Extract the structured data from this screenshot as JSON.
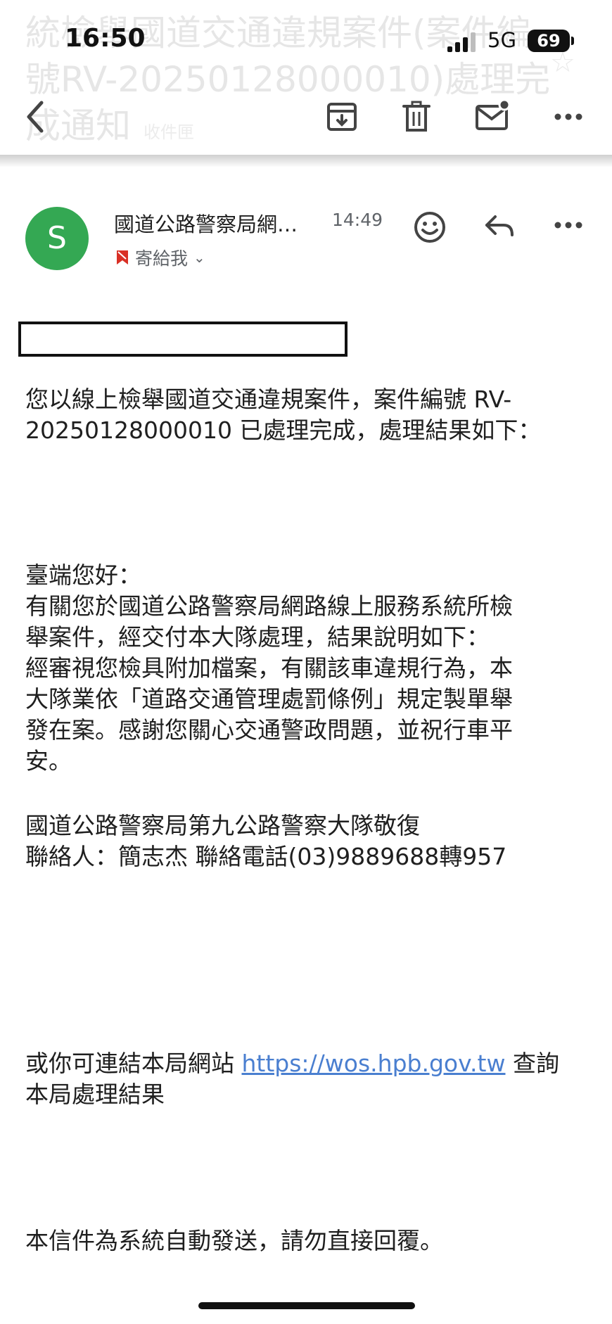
{
  "subject_ghost": {
    "title": "統檢舉國道交通違規案件(案件編號RV-20250128000010)處理完成通知",
    "folder": "收件匣"
  },
  "status_bar": {
    "time": "16:50",
    "network": "5G",
    "battery": "69"
  },
  "toolbar": {
    "icons": [
      "back-icon",
      "archive-icon",
      "trash-icon",
      "mark-unread-icon",
      "more-icon"
    ]
  },
  "message": {
    "avatar_letter": "S",
    "avatar_color": "#34a853",
    "sender": "國道公路警察局網…",
    "time": "14:49",
    "to": "寄給我",
    "body": {
      "intro_line1": "您以線上檢舉國道交通違規案件，案件編號 RV-",
      "intro_line2": "20250128000010 已處理完成，處理結果如下：",
      "lines": [
        "臺端您好：",
        "有關您於國道公路警察局網路線上服務系統所檢",
        "舉案件，經交付本大隊處理，結果說明如下：",
        "經審視您檢具附加檔案，有關該車違規行為，本",
        "大隊業依「道路交通管理處罰條例」規定製單舉",
        "發在案。感謝您關心交通警政問題，並祝行車平",
        "安。"
      ],
      "signature": [
        "國道公路警察局第九公路警察大隊敬復",
        "聯絡人：簡志杰 聯絡電話(03)9889688轉957"
      ],
      "link_prefix": "或你可連結本局網站 ",
      "link_text": "https://wos.hpb.gov.tw",
      "link_suffix": " 查詢",
      "link_line2": "本局處理結果",
      "footer": "本信件為系統自動發送，請勿直接回覆。"
    }
  }
}
